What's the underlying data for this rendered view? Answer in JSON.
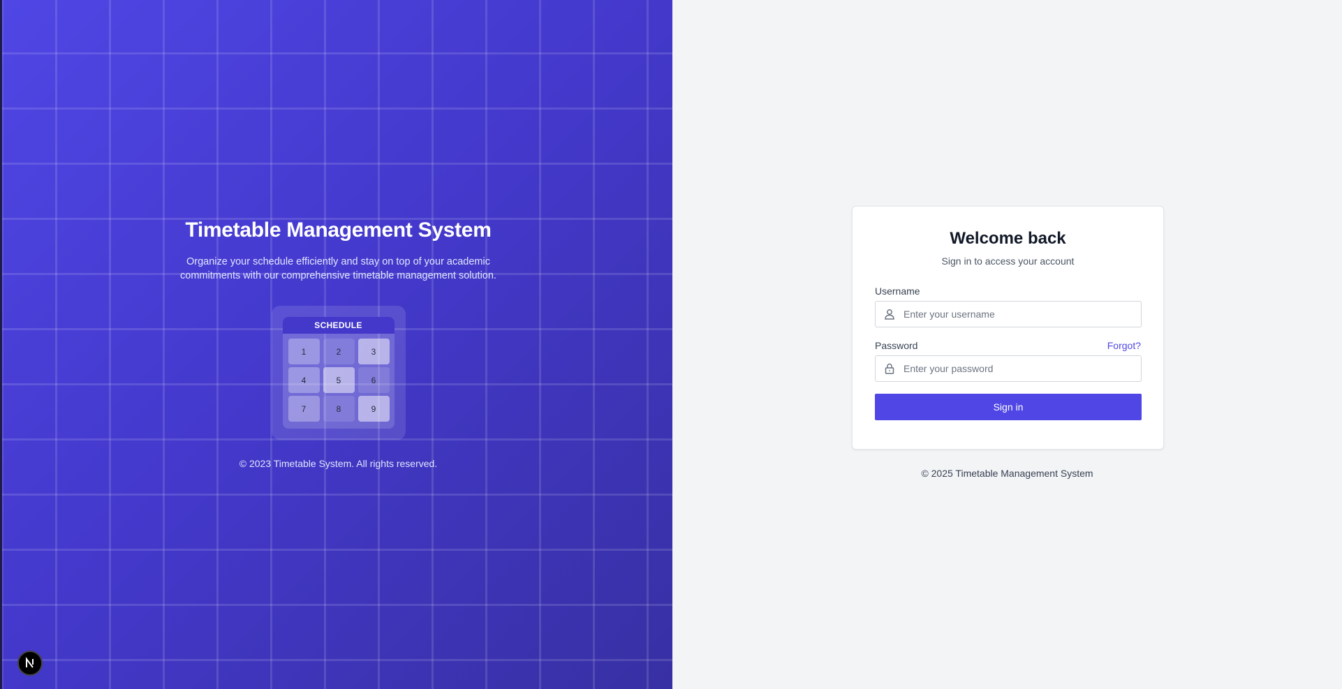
{
  "brand": {
    "title": "Timetable Management System",
    "description": "Organize your schedule efficiently and stay on top of your academic commitments with our comprehensive timetable management solution.",
    "footer": "© 2023 Timetable System. All rights reserved."
  },
  "schedule": {
    "header": "SCHEDULE",
    "cells": [
      "1",
      "2",
      "3",
      "4",
      "5",
      "6",
      "7",
      "8",
      "9"
    ]
  },
  "login": {
    "title": "Welcome back",
    "subtitle": "Sign in to access your account",
    "username_label": "Username",
    "username_placeholder": "Enter your username",
    "password_label": "Password",
    "password_placeholder": "Enter your password",
    "forgot_label": "Forgot?",
    "submit_label": "Sign in"
  },
  "footer": {
    "text": "© 2025 Timetable Management System"
  },
  "icons": {
    "username": "user-icon",
    "password": "lock-icon",
    "dev_badge": "nextjs-logo-icon"
  },
  "colors": {
    "accent": "#4f46e5",
    "panel_gradient_start": "#4f46e5",
    "panel_gradient_end": "#3730a3"
  }
}
